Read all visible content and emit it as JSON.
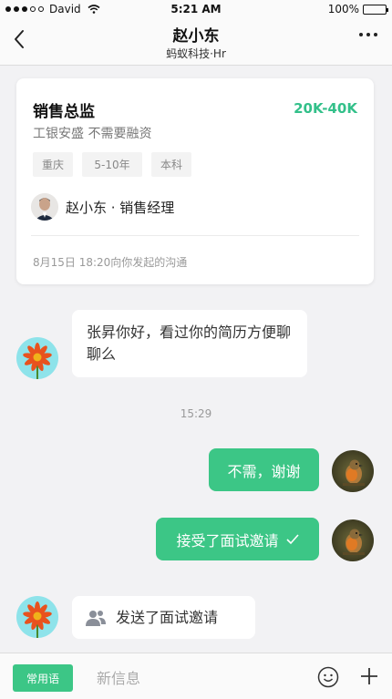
{
  "status_bar": {
    "carrier": "David",
    "time": "5:21 AM",
    "battery": "100%"
  },
  "nav": {
    "title": "赵小东",
    "subtitle": "蚂蚁科技·Hr"
  },
  "job_card": {
    "title": "销售总监",
    "salary": "20K-40K",
    "company_desc": "工银安盛 不需要融资",
    "tags": [
      "重庆",
      "5-10年",
      "本科"
    ],
    "recruiter": "赵小东 · 销售经理",
    "comm_time": "8月15日 18:20向你发起的沟通"
  },
  "messages": {
    "m1": "张昇你好，看过你的简历方便聊聊么",
    "timestamp": "15:29",
    "m2": "不需，谢谢",
    "m3": "接受了面试邀请",
    "m4": "发送了面试邀请"
  },
  "input_bar": {
    "phrases_label": "常用语",
    "placeholder": "新信息"
  },
  "colors": {
    "accent": "#3cc686",
    "salary": "#33c08a"
  }
}
